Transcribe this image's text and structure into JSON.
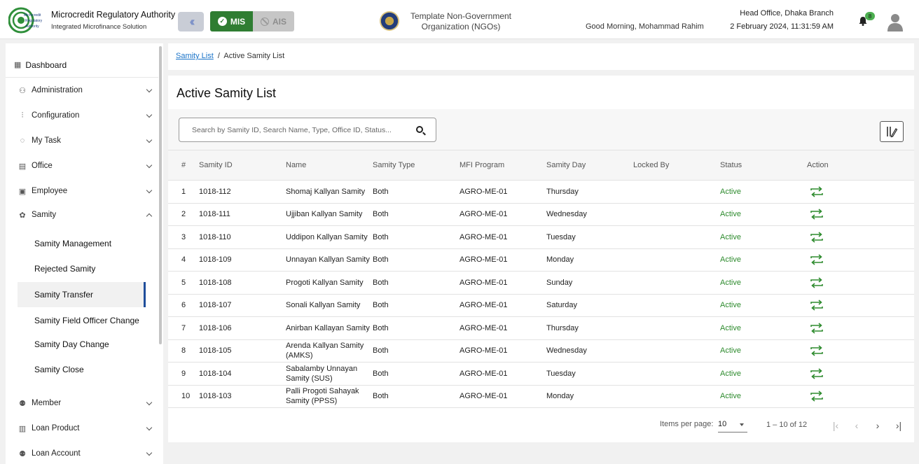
{
  "header": {
    "brand_title": "Microcredit Regulatory Authority",
    "brand_subtitle": "Integrated Microfinance Solution",
    "logo_text": "Microcredit Regulatory Authority",
    "mode_mis": "MIS",
    "mode_ais": "AIS",
    "org_name": "Template Non-Government Organization (NGOs)",
    "greeting": "Good Morning, Mohammad Rahim",
    "branch": "Head Office, Dhaka Branch",
    "datetime": "2 February 2024, 11:31:59 AM",
    "notification_count": "8"
  },
  "sidebar": {
    "dashboard": "Dashboard",
    "items": [
      {
        "label": "Administration",
        "icon": "admin-icon"
      },
      {
        "label": "Configuration",
        "icon": "sliders-icon"
      },
      {
        "label": "My Task",
        "icon": "refresh-icon"
      },
      {
        "label": "Office",
        "icon": "building-icon"
      },
      {
        "label": "Employee",
        "icon": "id-card-icon"
      },
      {
        "label": "Samity",
        "icon": "group-icon"
      },
      {
        "label": "Member",
        "icon": "users-icon"
      },
      {
        "label": "Loan Product",
        "icon": "box-icon"
      },
      {
        "label": "Loan Account",
        "icon": "account-icon"
      }
    ],
    "samity_sub": [
      "Samity Management",
      "Rejected Samity",
      "Samity Transfer",
      "Samity Field Officer Change",
      "Samity Day Change",
      "Samity Close"
    ]
  },
  "breadcrumb": {
    "link": "Samity List",
    "separator": "/",
    "current": "Active Samity List"
  },
  "main": {
    "title": "Active Samity List",
    "search_placeholder": "Search by Samity ID, Search Name, Type, Office ID, Status...",
    "columns": [
      "#",
      "Samity ID",
      "Name",
      "Samity Type",
      "MFI Program",
      "Samity Day",
      "Locked By",
      "Status",
      "Action"
    ],
    "rows": [
      {
        "n": "1",
        "id": "1018-112",
        "name": "Shomaj Kallyan Samity",
        "type": "Both",
        "program": "AGRO-ME-01",
        "day": "Thursday",
        "locked": "",
        "status": "Active"
      },
      {
        "n": "2",
        "id": "1018-111",
        "name": "Ujjiban Kallyan Samity",
        "type": "Both",
        "program": "AGRO-ME-01",
        "day": "Wednesday",
        "locked": "",
        "status": "Active"
      },
      {
        "n": "3",
        "id": "1018-110",
        "name": "Uddipon Kallyan Samity",
        "type": "Both",
        "program": "AGRO-ME-01",
        "day": "Tuesday",
        "locked": "",
        "status": "Active"
      },
      {
        "n": "4",
        "id": "1018-109",
        "name": "Unnayan Kallyan Samity",
        "type": "Both",
        "program": "AGRO-ME-01",
        "day": "Monday",
        "locked": "",
        "status": "Active"
      },
      {
        "n": "5",
        "id": "1018-108",
        "name": "Progoti Kallyan Samity",
        "type": "Both",
        "program": "AGRO-ME-01",
        "day": "Sunday",
        "locked": "",
        "status": "Active"
      },
      {
        "n": "6",
        "id": "1018-107",
        "name": "Sonali Kallyan Samity",
        "type": "Both",
        "program": "AGRO-ME-01",
        "day": "Saturday",
        "locked": "",
        "status": "Active"
      },
      {
        "n": "7",
        "id": "1018-106",
        "name": "Anirban Kallayan Samity",
        "type": "Both",
        "program": "AGRO-ME-01",
        "day": "Thursday",
        "locked": "",
        "status": "Active"
      },
      {
        "n": "8",
        "id": "1018-105",
        "name": "Arenda Kallyan Samity (AMKS)",
        "type": "Both",
        "program": "AGRO-ME-01",
        "day": "Wednesday",
        "locked": "",
        "status": "Active"
      },
      {
        "n": "9",
        "id": "1018-104",
        "name": "Sabalamby Unnayan Samity (SUS)",
        "type": "Both",
        "program": "AGRO-ME-01",
        "day": "Tuesday",
        "locked": "",
        "status": "Active"
      },
      {
        "n": "10",
        "id": "1018-103",
        "name": "Palli Progoti Sahayak Samity (PPSS)",
        "type": "Both",
        "program": "AGRO-ME-01",
        "day": "Monday",
        "locked": "",
        "status": "Active"
      }
    ],
    "status_color": "#2e8b2e",
    "action_color": "#2e8b2e"
  },
  "pagination": {
    "items_per_page_label": "Items per page:",
    "items_per_page": "10",
    "range": "1 – 10 of 12"
  },
  "colors": {
    "mis_green": "#2f7d32",
    "active_nav": "#1f4e9b",
    "link": "#1a73c8"
  }
}
